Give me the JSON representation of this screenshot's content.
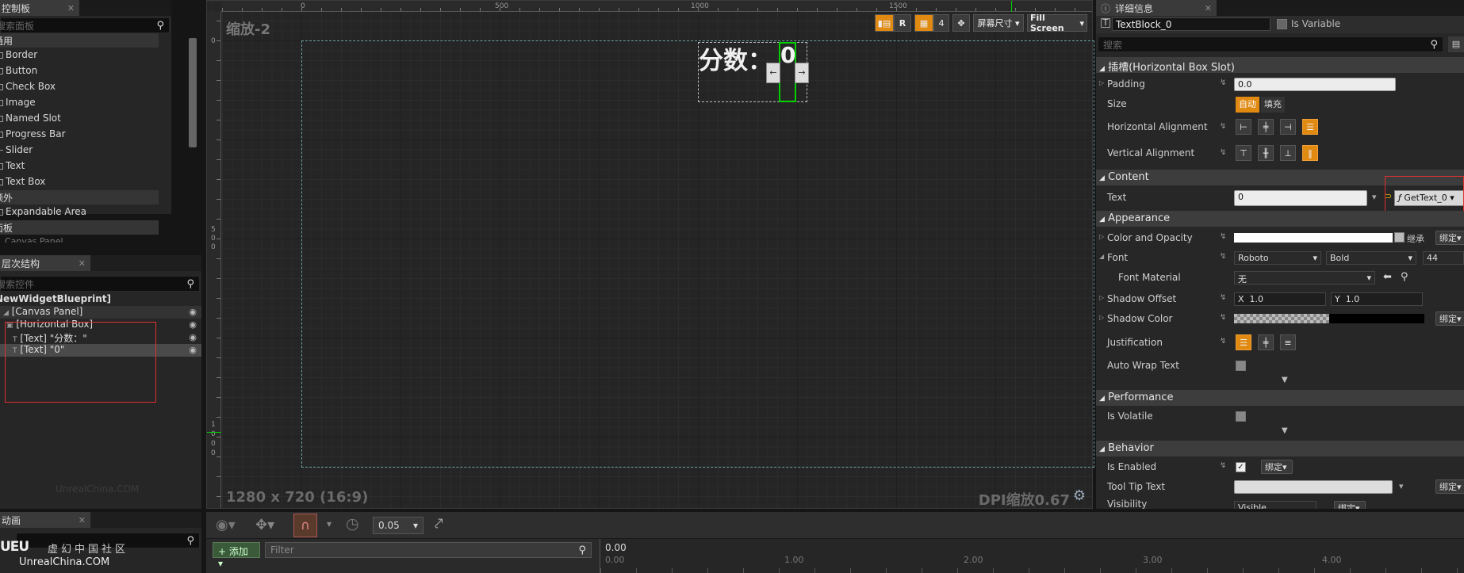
{
  "palette": {
    "tab_label": "控制板",
    "search_placeholder": "搜索面板",
    "categories": [
      {
        "label": "通用",
        "items": [
          "Border",
          "Button",
          "Check Box",
          "Image",
          "Named Slot",
          "Progress Bar",
          "Slider",
          "Text",
          "Text Box"
        ]
      },
      {
        "label": "额外",
        "items": [
          "Expandable Area"
        ]
      },
      {
        "label": "面板",
        "items": [
          "Canvas Panel"
        ]
      }
    ]
  },
  "hierarchy": {
    "tab_label": "层次结构",
    "search_placeholder": "搜索控件",
    "root": "NewWidgetBlueprint]",
    "rows": [
      "[Canvas Panel]",
      "[Horizontal Box]",
      "[Text] \"分数：\"",
      "[Text] \"0\""
    ]
  },
  "designer": {
    "zoom_label": "缩放-2",
    "ruler_x": [
      "0",
      "500",
      "1000",
      "1500"
    ],
    "ruler_y": [
      {
        "lines": [
          "0"
        ]
      },
      {
        "lines": [
          "5",
          "0",
          "0"
        ]
      },
      {
        "lines": [
          "1",
          "0",
          "0",
          "0"
        ]
      }
    ],
    "score_label": "分数：",
    "score_value": "0",
    "resolution": "1280 x 720 (16:9)",
    "dpi": "DPI缩放0.67",
    "watermark": "UnrealChina.COM",
    "toolbar": {
      "r_label": "R",
      "grid_count": "4",
      "screen_size": "屏幕尺寸",
      "fill_screen": "Fill Screen"
    }
  },
  "animations": {
    "tab_label": "动画",
    "add_label": "添加",
    "site_logo_cn": "虚幻中国社区",
    "site_logo_en": "UnrealChina.COM"
  },
  "timeline": {
    "snap_value": "0.05",
    "filter_placeholder": "Filter",
    "marks": [
      "0.00",
      "1.00",
      "2.00",
      "3.00",
      "4.00"
    ],
    "current_time": "0.00"
  },
  "details": {
    "tab_label": "详细信息",
    "widget_name": "TextBlock_0",
    "is_variable": "Is Variable",
    "search_placeholder": "搜索",
    "slot_section": "插槽(Horizontal Box Slot)",
    "padding_label": "Padding",
    "padding_value": "0.0",
    "size_label": "Size",
    "size_auto": "自动",
    "size_fill": "填充",
    "halign_label": "Horizontal Alignment",
    "valign_label": "Vertical Alignment",
    "content_section": "Content",
    "text_label": "Text",
    "text_value": "0",
    "bind_function": "GetText_0",
    "appearance_section": "Appearance",
    "color_label": "Color and Opacity",
    "inherit_label": "继承",
    "bind_label": "绑定",
    "font_label": "Font",
    "font_family": "Roboto",
    "font_style": "Bold",
    "font_size": "44",
    "font_material_label": "Font Material",
    "font_material_value": "无",
    "shadow_offset_label": "Shadow Offset",
    "shadow_x": "1.0",
    "shadow_y": "1.0",
    "shadow_color_label": "Shadow Color",
    "justification_label": "Justification",
    "autowrap_label": "Auto Wrap Text",
    "performance_section": "Performance",
    "volatile_label": "Is Volatile",
    "behavior_section": "Behavior",
    "enabled_label": "Is Enabled",
    "tooltip_label": "Tool Tip Text",
    "visibility_label": "Visibility",
    "visibility_value": "Visible"
  },
  "colors": {
    "accent": "#e08a12",
    "selection": "#00c000",
    "annotation": "#e03030"
  }
}
